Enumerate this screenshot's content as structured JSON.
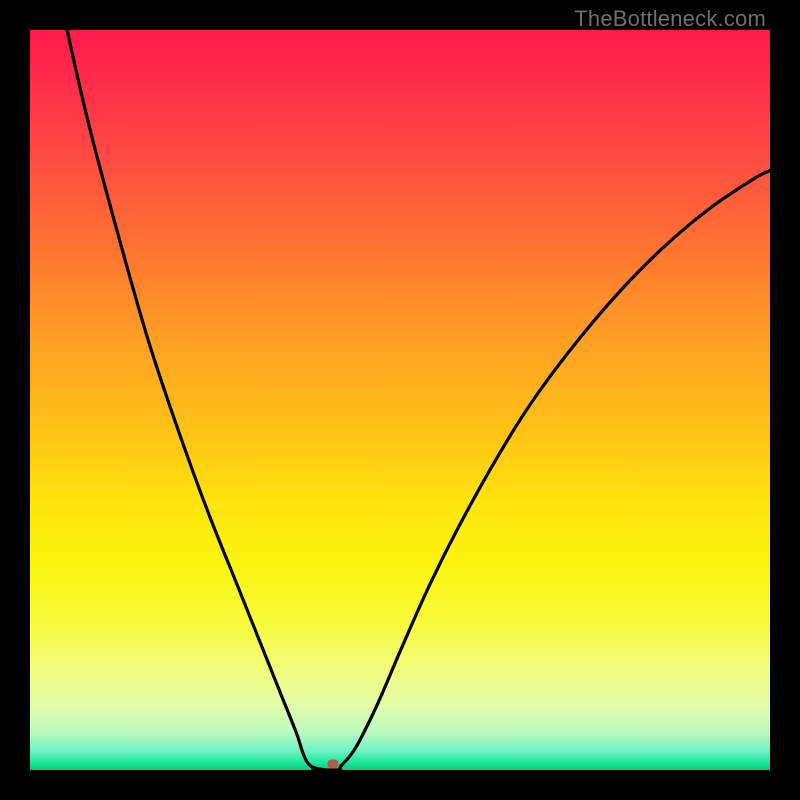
{
  "watermark": {
    "text": "TheBottleneck.com"
  },
  "colors": {
    "frame_bg": "#000000",
    "curve": "#000000",
    "marker": "#b85a4a",
    "gradient_top": "#ff1a4a",
    "gradient_bottom": "#0cc97b"
  },
  "chart_data": {
    "type": "line",
    "title": "",
    "xlabel": "",
    "ylabel": "",
    "xlim": [
      0,
      100
    ],
    "ylim": [
      0,
      100
    ],
    "grid": false,
    "legend": false,
    "series": [
      {
        "name": "left-branch",
        "x": [
          5,
          8,
          12,
          16,
          20,
          24,
          28,
          32,
          34,
          36,
          37,
          38,
          40
        ],
        "values": [
          100,
          87,
          72,
          58,
          46,
          35,
          25,
          15,
          10,
          5,
          2,
          0.5,
          0
        ]
      },
      {
        "name": "right-branch",
        "x": [
          42,
          44,
          47,
          50,
          54,
          58,
          63,
          68,
          74,
          80,
          86,
          92,
          98,
          100
        ],
        "values": [
          0.5,
          3,
          9,
          16,
          25,
          33,
          42,
          50,
          58,
          65,
          71,
          76,
          80,
          81
        ]
      }
    ],
    "flat_segment": {
      "x_start": 38,
      "x_end": 42,
      "y": 0
    },
    "marker": {
      "x": 41,
      "y": 0.8
    },
    "annotation": "V-shaped bottleneck curve on rainbow heat background"
  }
}
